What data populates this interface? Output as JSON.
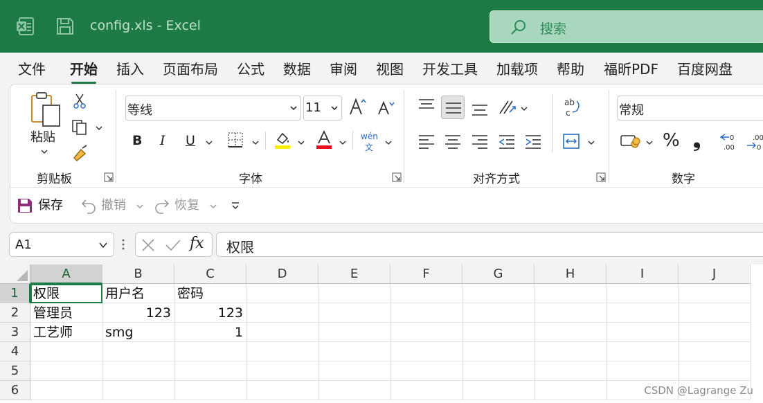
{
  "titlebar": {
    "file_title": "config.xls  -  Excel",
    "search_placeholder": "搜索",
    "color": "#1d7a45"
  },
  "menu": {
    "tabs": [
      {
        "label": "文件",
        "active": false
      },
      {
        "label": "开始",
        "active": true
      },
      {
        "label": "插入",
        "active": false
      },
      {
        "label": "页面布局",
        "active": false
      },
      {
        "label": "公式",
        "active": false
      },
      {
        "label": "数据",
        "active": false
      },
      {
        "label": "审阅",
        "active": false
      },
      {
        "label": "视图",
        "active": false
      },
      {
        "label": "开发工具",
        "active": false
      },
      {
        "label": "加载项",
        "active": false
      },
      {
        "label": "帮助",
        "active": false
      },
      {
        "label": "福昕PDF",
        "active": false
      },
      {
        "label": "百度网盘",
        "active": false
      }
    ]
  },
  "ribbon": {
    "clipboard": {
      "group_label": "剪贴板",
      "paste_label": "粘贴"
    },
    "font": {
      "group_label": "字体",
      "font_name": "等线",
      "font_size": "11",
      "bold": "B",
      "italic": "I",
      "underline": "U",
      "pinyin_top": "wén",
      "pinyin_bottom": "文"
    },
    "alignment": {
      "group_label": "对齐方式"
    },
    "number": {
      "group_label": "数字",
      "format": "常规",
      "percent": "%",
      "comma": "❟"
    }
  },
  "quick_access": {
    "save_label": "保存",
    "undo_label": "撤销",
    "redo_label": "恢复"
  },
  "formula_bar": {
    "name_box": "A1",
    "fx_label": "fx",
    "content": "权限"
  },
  "sheet": {
    "columns": [
      "A",
      "B",
      "C",
      "D",
      "E",
      "F",
      "G",
      "H",
      "I",
      "J"
    ],
    "rows": [
      "1",
      "2",
      "3",
      "4",
      "5",
      "6"
    ],
    "cells": {
      "A1": "权限",
      "B1": "用户名",
      "C1": "密码",
      "A2": "管理员",
      "B2": "123",
      "C2": "123",
      "A3": "工艺师",
      "B3": "smg",
      "C3": "1"
    },
    "selected_cell": "A1"
  },
  "watermark": "CSDN @Lagrange Zu"
}
